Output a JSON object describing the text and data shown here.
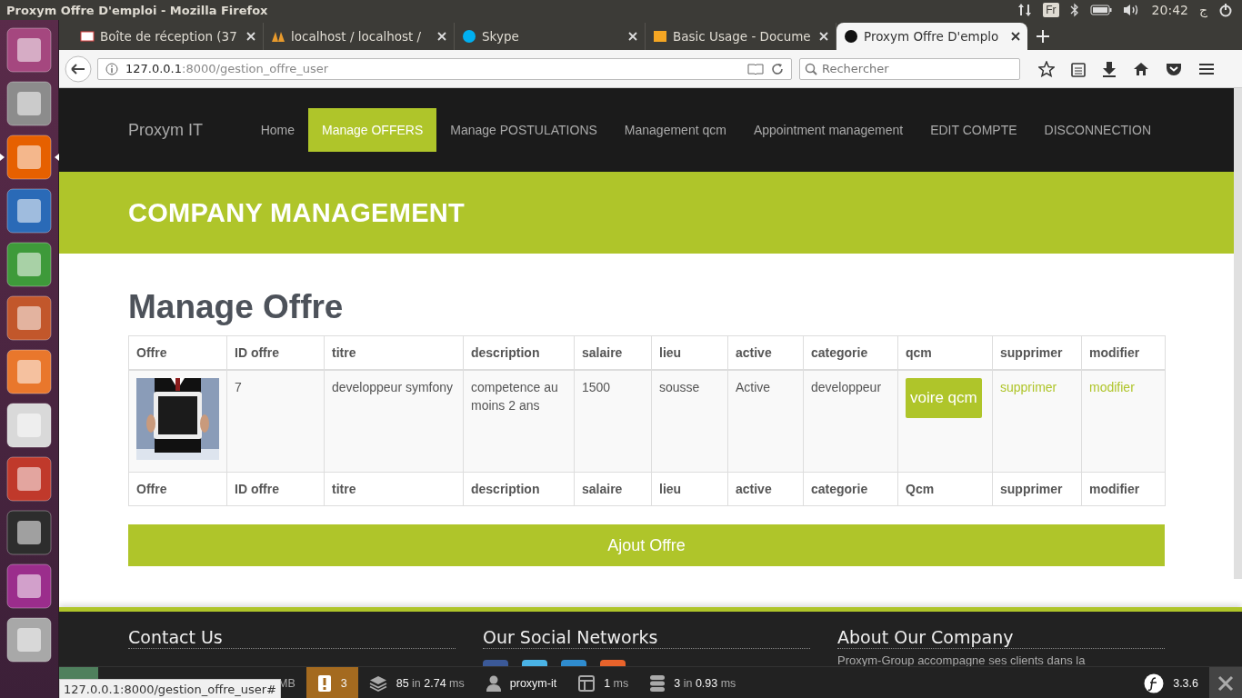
{
  "window": {
    "title": "Proxym Offre D'emploi - Mozilla Firefox"
  },
  "system_tray": {
    "keyboard": "Fr",
    "time": "20:42",
    "user": "ج"
  },
  "launcher": [
    {
      "color": "#a5477f",
      "selected": false
    },
    {
      "color": "#8c8c8c",
      "selected": false
    },
    {
      "color": "#e66000",
      "selected": true
    },
    {
      "color": "#2a6ab7",
      "selected": false
    },
    {
      "color": "#3e9a3a",
      "selected": false
    },
    {
      "color": "#c2572b",
      "selected": false
    },
    {
      "color": "#e9772c",
      "selected": false
    },
    {
      "color": "#d9d9d9",
      "selected": false
    },
    {
      "color": "#c0392b",
      "selected": false
    },
    {
      "color": "#2d2d2d",
      "selected": false
    },
    {
      "color": "#9b2d8c",
      "selected": false
    },
    {
      "color": "#a8a8a8",
      "selected": false
    }
  ],
  "tabs": [
    {
      "label": "Boîte de réception (37",
      "selected": false
    },
    {
      "label": "localhost / localhost /",
      "selected": false
    },
    {
      "label": "Skype",
      "selected": false
    },
    {
      "label": "Basic Usage - Docume",
      "selected": false
    },
    {
      "label": "Proxym Offre D'emplo",
      "selected": true
    }
  ],
  "address_bar": {
    "host": "127.0.0.1",
    "path": ":8000/gestion_offre_user"
  },
  "search": {
    "placeholder": "Rechercher"
  },
  "site": {
    "brand": "Proxym IT",
    "nav": [
      {
        "label": "Home",
        "selected": false
      },
      {
        "label": "Manage OFFERS",
        "selected": true
      },
      {
        "label": "Manage POSTULATIONS",
        "selected": false
      },
      {
        "label": "Management qcm",
        "selected": false
      },
      {
        "label": "Appointment management",
        "selected": false
      },
      {
        "label": "EDIT COMPTE",
        "selected": false
      },
      {
        "label": "DISCONNECTION",
        "selected": false
      }
    ]
  },
  "banner": {
    "title": "COMPANY MANAGEMENT"
  },
  "heading": "Manage Offre",
  "table": {
    "columns": [
      "Offre",
      "ID offre",
      "titre",
      "description",
      "salaire",
      "lieu",
      "active",
      "categorie",
      "qcm",
      "supprimer",
      "modifier"
    ],
    "rows": [
      {
        "cells": [
          {
            "kind": "picture"
          },
          {
            "kind": "text",
            "text": "7"
          },
          {
            "kind": "text",
            "text": "developpeur symfony"
          },
          {
            "kind": "text",
            "text": "competence au moins 2 ans"
          },
          {
            "kind": "text",
            "text": "1500"
          },
          {
            "kind": "text",
            "text": "sousse"
          },
          {
            "kind": "text",
            "text": "Active"
          },
          {
            "kind": "text",
            "text": "developpeur"
          },
          {
            "kind": "button",
            "text": "voire qcm"
          },
          {
            "kind": "link",
            "text": "supprimer"
          },
          {
            "kind": "link",
            "text": "modifier"
          }
        ]
      }
    ],
    "footer_columns": [
      "Offre",
      "ID offre",
      "titre",
      "description",
      "salaire",
      "lieu",
      "active",
      "categorie",
      "Qcm",
      "supprimer",
      "modifier"
    ]
  },
  "add_button": "Ajout Offre",
  "footer": {
    "columns": [
      {
        "title": "Contact Us"
      },
      {
        "title": "Our Social Networks"
      },
      {
        "title": "About Our Company",
        "text": "Proxym-Group accompagne ses clients dans la"
      }
    ],
    "social_icons": [
      {
        "color": "#3b5998"
      },
      {
        "color": "#4ab3e6"
      },
      {
        "color": "#2f8ccf"
      },
      {
        "color": "#e8632b"
      }
    ]
  },
  "debug_toolbar": {
    "items": [
      {
        "kind": "memory",
        "parts": [
          {
            "text": "MB",
            "muted": true
          }
        ]
      },
      {
        "kind": "warnings",
        "parts": [
          {
            "text": "3",
            "muted": false
          }
        ]
      },
      {
        "kind": "layers",
        "parts": [
          {
            "text": "85",
            "muted": false
          },
          {
            "text": "in",
            "muted": true
          },
          {
            "text": "2.74",
            "muted": false
          },
          {
            "text": "ms",
            "muted": true
          }
        ]
      },
      {
        "kind": "user",
        "parts": [
          {
            "text": "proxym-it",
            "muted": false
          }
        ]
      },
      {
        "kind": "time",
        "parts": [
          {
            "text": "1",
            "muted": false
          },
          {
            "text": "ms",
            "muted": true
          }
        ]
      },
      {
        "kind": "database",
        "parts": [
          {
            "text": "3",
            "muted": false
          },
          {
            "text": "in",
            "muted": true
          },
          {
            "text": "0.93",
            "muted": false
          },
          {
            "text": "ms",
            "muted": true
          }
        ]
      }
    ],
    "version": "3.3.6"
  },
  "status_tooltip": "127.0.0.1:8000/gestion_offre_user#"
}
